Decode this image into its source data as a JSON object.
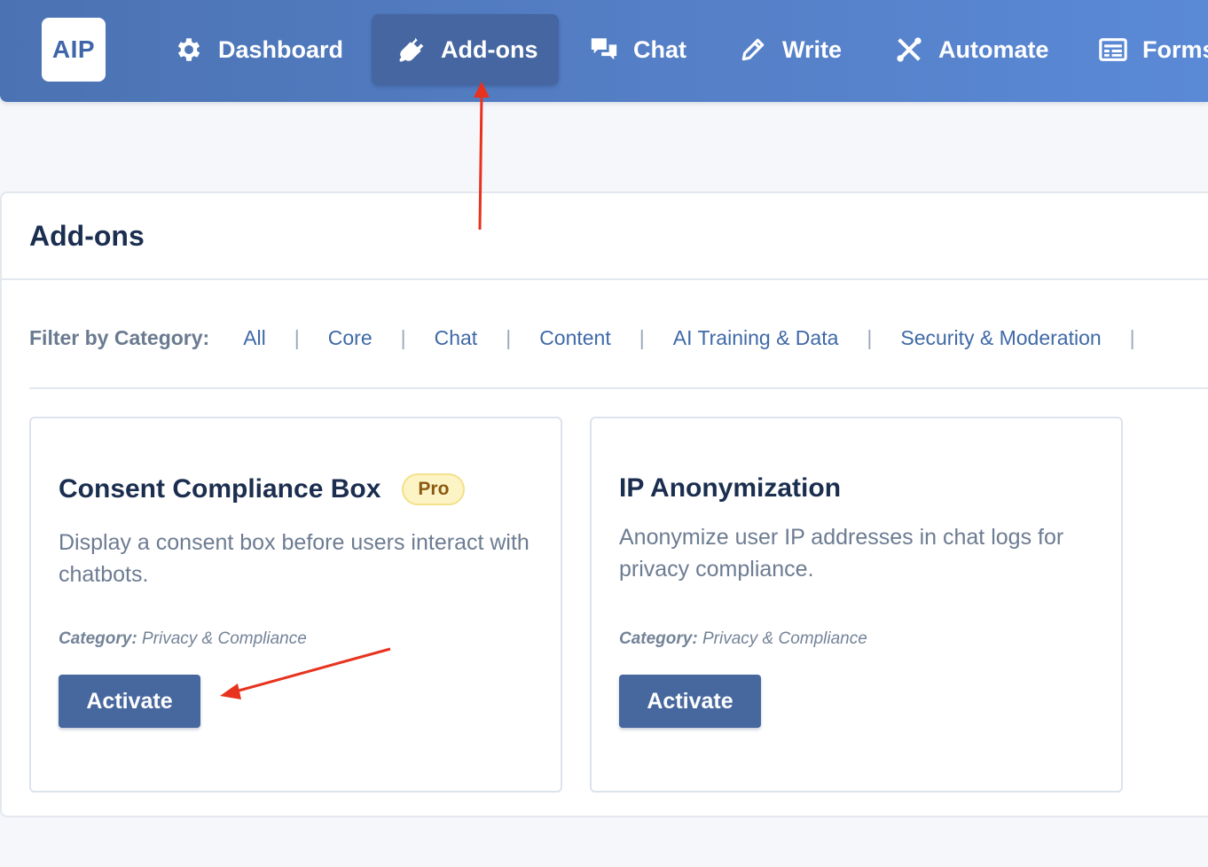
{
  "app": {
    "logo_text": "AIP",
    "brand_color": "#4b73b3",
    "active_nav_color": "#4566a0"
  },
  "nav": {
    "items": [
      {
        "label": "Dashboard",
        "icon": "gear-icon"
      },
      {
        "label": "Add-ons",
        "icon": "plug-icon",
        "active": true
      },
      {
        "label": "Chat",
        "icon": "chat-bubbles-icon"
      },
      {
        "label": "Write",
        "icon": "pencil-icon"
      },
      {
        "label": "Automate",
        "icon": "wrench-icon"
      },
      {
        "label": "Forms",
        "icon": "form-icon"
      }
    ]
  },
  "panel": {
    "title": "Add-ons"
  },
  "filter": {
    "label": "Filter by Category:",
    "categories": [
      "All",
      "Core",
      "Chat",
      "Content",
      "AI Training & Data",
      "Security & Moderation"
    ]
  },
  "cards": [
    {
      "title": "Consent Compliance Box",
      "badge": "Pro",
      "description": "Display a consent box before users interact with chatbots.",
      "category_label": "Category:",
      "category": "Privacy & Compliance",
      "button": "Activate"
    },
    {
      "title": "IP Anonymization",
      "description": "Anonymize user IP addresses in chat logs for privacy compliance.",
      "category_label": "Category:",
      "category": "Privacy & Compliance",
      "button": "Activate"
    }
  ],
  "annotation": {
    "arrow_color": "#e8321e"
  }
}
